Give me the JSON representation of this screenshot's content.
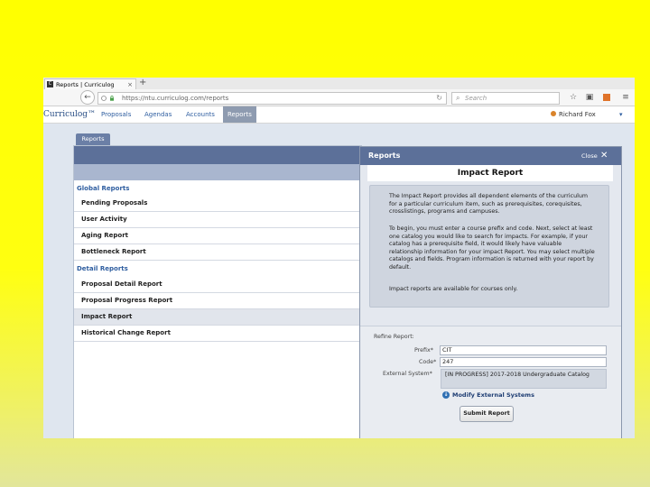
{
  "browser": {
    "tab_title": "Reports | Curriculog",
    "tab_close": "×",
    "new_tab": "+",
    "url": "https://ntu.curriculog.com/reports",
    "search_placeholder": "Search"
  },
  "app": {
    "logo": "Curriculog™",
    "nav": [
      "Proposals",
      "Agendas",
      "Accounts",
      "Reports"
    ],
    "active_nav": "Reports",
    "user": "Richard Fox",
    "caret": "▾"
  },
  "left": {
    "tab_label": "Reports",
    "global_heading": "Global Reports",
    "global_items": [
      "Pending Proposals",
      "User Activity",
      "Aging Report",
      "Bottleneck Report"
    ],
    "detail_heading": "Detail Reports",
    "detail_items": [
      "Proposal Detail Report",
      "Proposal Progress Report",
      "Impact Report",
      "Historical Change Report"
    ],
    "selected": "Impact Report"
  },
  "modal": {
    "title": "Reports",
    "close_label": "Close",
    "close_icon": "✕",
    "heading": "Impact Report",
    "description": [
      "The Impact Report provides all dependent elements of the curriculum for a particular curriculum item, such as prerequisites, corequisites, crosslistings, programs and campuses.",
      "To begin, you must enter a course prefix and code. Next, select at least one catalog you would like to search for impacts. For example, if your catalog has a prerequisite field, it would likely have valuable relationship information for your impact Report. You may select multiple catalogs and fields. Program information is returned with your report by default.",
      "Impact reports are available for courses only."
    ],
    "refine_label": "Refine Report:",
    "prefix_label": "Prefix*",
    "prefix_value": "CIT",
    "code_label": "Code*",
    "code_value": "247",
    "external_label": "External System*",
    "catalog": "[IN PROGRESS] 2017-2018 Undergraduate Catalog",
    "modify_link": "Modify External Systems",
    "submit": "Submit Report"
  }
}
